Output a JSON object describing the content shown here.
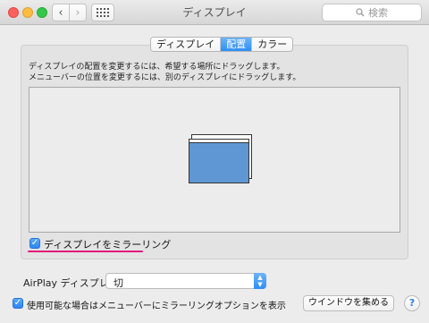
{
  "window": {
    "title": "ディスプレイ"
  },
  "toolbar": {
    "back_icon": "‹",
    "forward_icon": "›",
    "search_placeholder": "検索"
  },
  "tabs": [
    {
      "label": "ディスプレイ",
      "active": false
    },
    {
      "label": "配置",
      "active": true
    },
    {
      "label": "カラー",
      "active": false
    }
  ],
  "arrangement": {
    "instruction_line1": "ディスプレイの配置を変更するには、希望する場所にドラッグします。",
    "instruction_line2": "メニューバーの位置を変更するには、別のディスプレイにドラッグします。"
  },
  "mirror": {
    "label": "ディスプレイをミラーリング",
    "checked": true
  },
  "airplay": {
    "label": "AirPlay ディスプレイ：",
    "value": "切"
  },
  "menu_option": {
    "label": "使用可能な場合はメニューバーにミラーリングオプションを表示",
    "checked": true
  },
  "buttons": {
    "gather_windows": "ウインドウを集める",
    "help": "?"
  },
  "colors": {
    "accent": "#2d8ef5",
    "highlight_underline": "#e2197a",
    "display_fill": "#5f97d5"
  }
}
